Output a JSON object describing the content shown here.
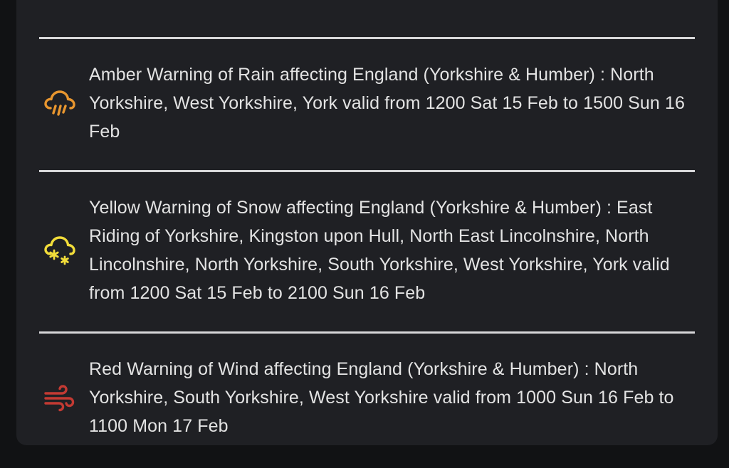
{
  "warnings": [
    {
      "icon": "rain-cloud-icon",
      "color": "#e8962f",
      "text": "Amber Warning of Rain affecting England (Yorkshire & Humber) : North Yorkshire, West Yorkshire, York valid from 1200 Sat 15 Feb to 1500 Sun 16 Feb"
    },
    {
      "icon": "snow-cloud-icon",
      "color": "#f2dd3a",
      "text": "Yellow Warning of Snow affecting England (Yorkshire & Humber) : East Riding of Yorkshire, Kingston upon Hull, North East Lincolnshire, North Lincolnshire, North Yorkshire, South Yorkshire, West Yorkshire, York valid from 1200 Sat 15 Feb to 2100 Sun 16 Feb"
    },
    {
      "icon": "wind-icon",
      "color": "#c33a33",
      "text": "Red Warning of Wind affecting England (Yorkshire & Humber) : North Yorkshire, South Yorkshire, West Yorkshire valid from 1000 Sun 16 Feb to 1100 Mon 17 Feb"
    }
  ]
}
